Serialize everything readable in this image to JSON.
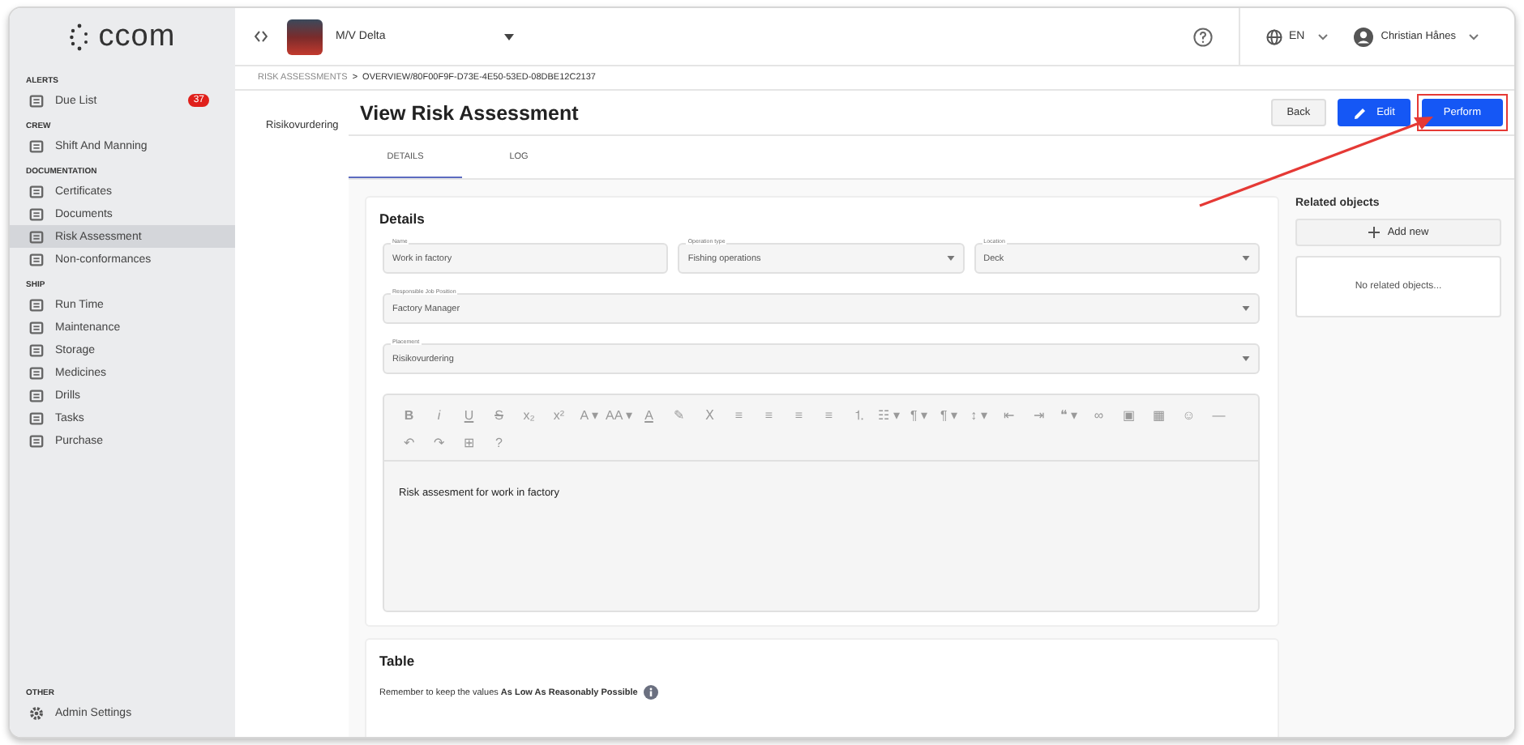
{
  "sidebar": {
    "logo": "ccom",
    "sections": [
      {
        "title": "ALERTS",
        "items": [
          {
            "label": "Due List",
            "selected": false,
            "badge": "37"
          }
        ]
      },
      {
        "title": "CREW",
        "items": [
          {
            "label": "Shift And Manning",
            "selected": false
          }
        ]
      },
      {
        "title": "DOCUMENTATION",
        "items": [
          {
            "label": "Certificates",
            "selected": false
          },
          {
            "label": "Documents",
            "selected": false
          },
          {
            "label": "Risk Assessment",
            "selected": true
          },
          {
            "label": "Non-conformances",
            "selected": false
          }
        ]
      },
      {
        "title": "SHIP",
        "items": [
          {
            "label": "Run Time",
            "selected": false
          },
          {
            "label": "Maintenance",
            "selected": false
          },
          {
            "label": "Storage",
            "selected": false
          },
          {
            "label": "Medicines",
            "selected": false
          },
          {
            "label": "Drills",
            "selected": false
          },
          {
            "label": "Tasks",
            "selected": false
          },
          {
            "label": "Purchase",
            "selected": false
          }
        ]
      }
    ],
    "footer": {
      "title": "OTHER",
      "items": [
        {
          "label": "Admin Settings",
          "selected": false
        }
      ]
    }
  },
  "topbar": {
    "vessel": "M/V Delta",
    "language": "EN",
    "user": "Christian Hånes"
  },
  "breadcrumb": [
    "RISK ASSESSMENTS",
    ">",
    "OVERVIEW/80F00F9F-D73E-4E50-53ED-08DBE12C2137"
  ],
  "left_nav": [
    "Risikovurdering"
  ],
  "page": {
    "title": "View Risk Assessment",
    "buttons": [
      {
        "label": "Back",
        "kind": "plain",
        "highlighted": false
      },
      {
        "label": "Edit",
        "kind": "edit",
        "highlighted": false
      },
      {
        "label": "Perform",
        "kind": "primary",
        "highlighted": true
      }
    ]
  },
  "tabs": [
    {
      "label": "DETAILS",
      "selected": true
    },
    {
      "label": "LOG",
      "selected": false
    }
  ],
  "details": {
    "title": "Details",
    "fields": [
      [
        {
          "label": "Name",
          "value": "Work in factory",
          "kind": "text"
        },
        {
          "label": "Operation type",
          "value": "Fishing operations",
          "kind": "select"
        },
        {
          "label": "Location",
          "value": "Deck",
          "kind": "select"
        }
      ],
      [
        {
          "label": "Responsible Job Position",
          "value": "Factory Manager",
          "kind": "select"
        }
      ],
      [
        {
          "label": "Placement",
          "value": "Risikovurdering",
          "kind": "select"
        }
      ]
    ],
    "editor": {
      "toolbar": [
        [
          {
            "glyph": "B",
            "kind": "bold"
          },
          {
            "glyph": "i",
            "kind": "italic"
          },
          {
            "glyph": "U",
            "kind": "underline"
          },
          {
            "glyph": "S",
            "kind": "strike"
          },
          {
            "glyph": "x₂",
            "kind": "plain"
          },
          {
            "glyph": "x²",
            "kind": "plain"
          },
          {
            "glyph": "A ▾",
            "kind": "plain"
          },
          {
            "glyph": "AA ▾",
            "kind": "plain"
          },
          {
            "glyph": "A",
            "kind": "underline"
          },
          {
            "glyph": "✎",
            "kind": "plain"
          },
          {
            "glyph": "Ⅹ",
            "kind": "plain"
          },
          {
            "glyph": "≡",
            "kind": "plain"
          },
          {
            "glyph": "≡",
            "kind": "plain"
          },
          {
            "glyph": "≡",
            "kind": "plain"
          },
          {
            "glyph": "≡",
            "kind": "plain"
          },
          {
            "glyph": "⒈",
            "kind": "plain"
          },
          {
            "glyph": "☷ ▾",
            "kind": "plain"
          },
          {
            "glyph": "¶ ▾",
            "kind": "plain"
          },
          {
            "glyph": "¶ ▾",
            "kind": "plain"
          },
          {
            "glyph": "↕ ▾",
            "kind": "plain"
          },
          {
            "glyph": "⇤",
            "kind": "plain"
          },
          {
            "glyph": "⇥",
            "kind": "plain"
          },
          {
            "glyph": "❝ ▾",
            "kind": "plain"
          },
          {
            "glyph": "∞",
            "kind": "plain"
          },
          {
            "glyph": "▣",
            "kind": "plain"
          },
          {
            "glyph": "▦",
            "kind": "plain"
          },
          {
            "glyph": "☺",
            "kind": "plain"
          },
          {
            "glyph": "—",
            "kind": "plain"
          }
        ],
        [
          {
            "glyph": "↶",
            "kind": "plain"
          },
          {
            "glyph": "↷",
            "kind": "plain"
          },
          {
            "glyph": "⊞",
            "kind": "plain"
          },
          {
            "glyph": "?",
            "kind": "plain"
          }
        ]
      ],
      "content": "Risk assesment for work in factory"
    }
  },
  "table": {
    "title": "Table",
    "note": "Remember to keep the values **As Low As Reasonably Possible**"
  },
  "related": {
    "title": "Related objects",
    "add_button": "Add new",
    "empty_text": "No related objects..."
  }
}
